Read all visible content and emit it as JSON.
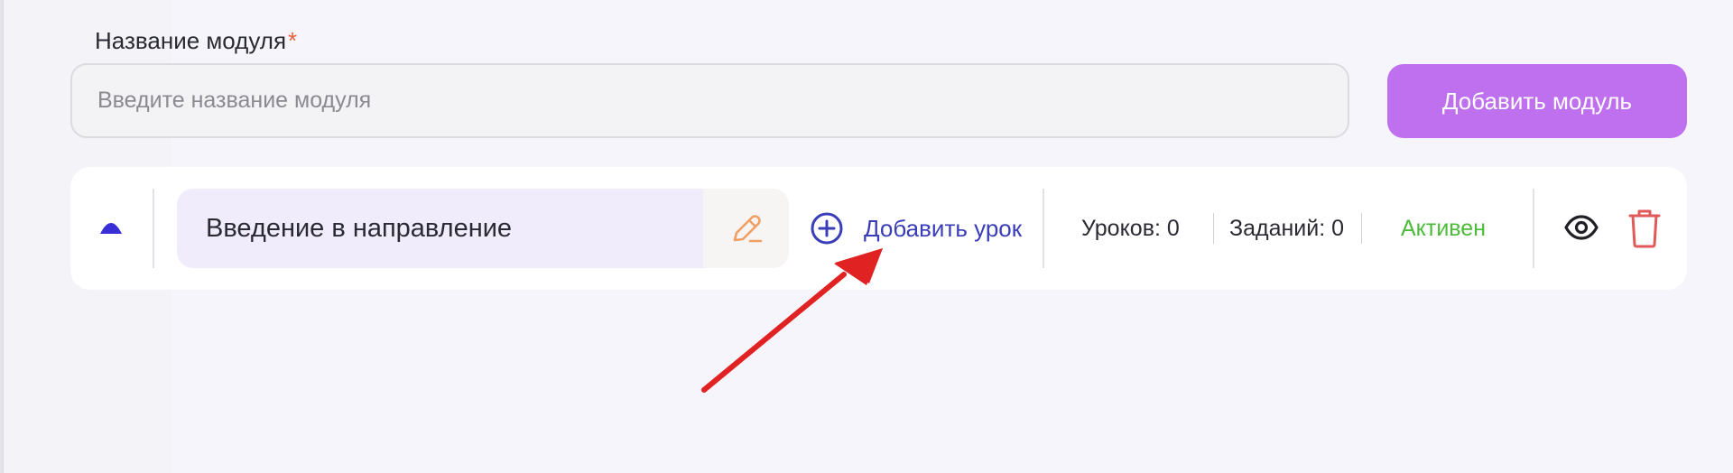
{
  "form": {
    "label": "Название модуля",
    "required_mark": "*",
    "input_placeholder": "Введите название модуля",
    "input_value": "",
    "add_module_label": "Добавить модуль"
  },
  "module": {
    "name": "Введение в направление",
    "add_lesson_label": "Добавить урок",
    "lessons_text": "Уроков: 0",
    "tasks_text": "Заданий: 0",
    "status_text": "Активен",
    "icons": {
      "collapse": "chevron-up-icon",
      "edit": "pencil-icon",
      "add": "plus-circle-icon",
      "view": "eye-icon",
      "delete": "trash-icon"
    }
  },
  "colors": {
    "accent_button": "#bf70ee",
    "link_blue": "#3a3db8",
    "status_green": "#4cbb3a",
    "delete_red": "#e05a5a",
    "edit_orange": "#f0a064",
    "annotation_arrow": "#e02222"
  }
}
